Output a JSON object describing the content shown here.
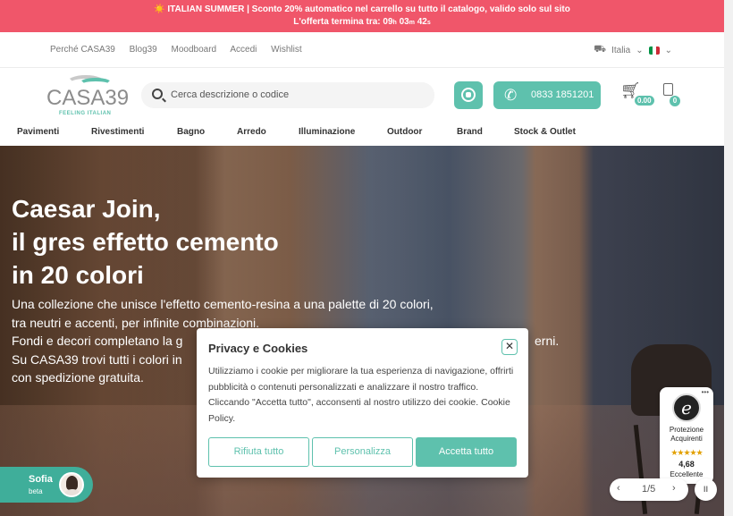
{
  "promo": {
    "line1": "☀️ ITALIAN SUMMER | Sconto 20% automatico nel carrello su tutto il catalogo, valido solo sul sito",
    "line2_label": "L'offerta termina tra:",
    "hours": "09",
    "hours_unit": "h",
    "minutes": "03",
    "minutes_unit": "m",
    "seconds": "42",
    "seconds_unit": "s"
  },
  "utility": {
    "links": [
      "Perché CASA39",
      "Blog39",
      "Moodboard",
      "Accedi",
      "Wishlist"
    ],
    "shipping_country": "Italia",
    "flag_colors": [
      "#009246",
      "#ffffff",
      "#ce2b37"
    ]
  },
  "header": {
    "logo_text": "CASA39",
    "logo_tagline": "FEELING ITALIAN",
    "search_placeholder": "Cerca descrizione o codice",
    "phone": "0833 1851201",
    "cart_total": "0.00",
    "list_count": "0"
  },
  "nav": [
    "Pavimenti",
    "Rivestimenti",
    "Bagno",
    "Arredo",
    "Illuminazione",
    "Outdoor",
    "Brand",
    "Stock & Outlet"
  ],
  "hero": {
    "title_lines": [
      "Caesar Join,",
      "il gres effetto cemento",
      "in 20 colori"
    ],
    "body_lines": [
      "Una collezione che unisce l'effetto cemento-resina a una palette di 20 colori,",
      "tra neutri e accenti, per infinite combinazioni.",
      "Fondi e decori completano la g",
      "Su CASA39 trovi tutti i colori in",
      "con spedizione gratuita."
    ],
    "body_tail": "erni.",
    "slide_counter": "1/5"
  },
  "chat": {
    "name": "Sofia",
    "status": "beta"
  },
  "trust_badge": {
    "label": "Protezione Acquirenti",
    "stars": "★★★★★",
    "score": "4,68",
    "rating_text": "Eccellente"
  },
  "cookie": {
    "title": "Privacy e Cookies",
    "text": "Utilizziamo i cookie per migliorare la tua esperienza di navigazione, offrirti pubblicità o contenuti personalizzati e analizzare il nostro traffico. Cliccando \"Accetta tutto\", acconsenti al nostro utilizzo dei cookie. Cookie Policy.",
    "reject": "Rifiuta tutto",
    "customize": "Personalizza",
    "accept": "Accetta tutto"
  },
  "colors": {
    "accent": "#5ec1ad",
    "promo": "#f0566a"
  }
}
